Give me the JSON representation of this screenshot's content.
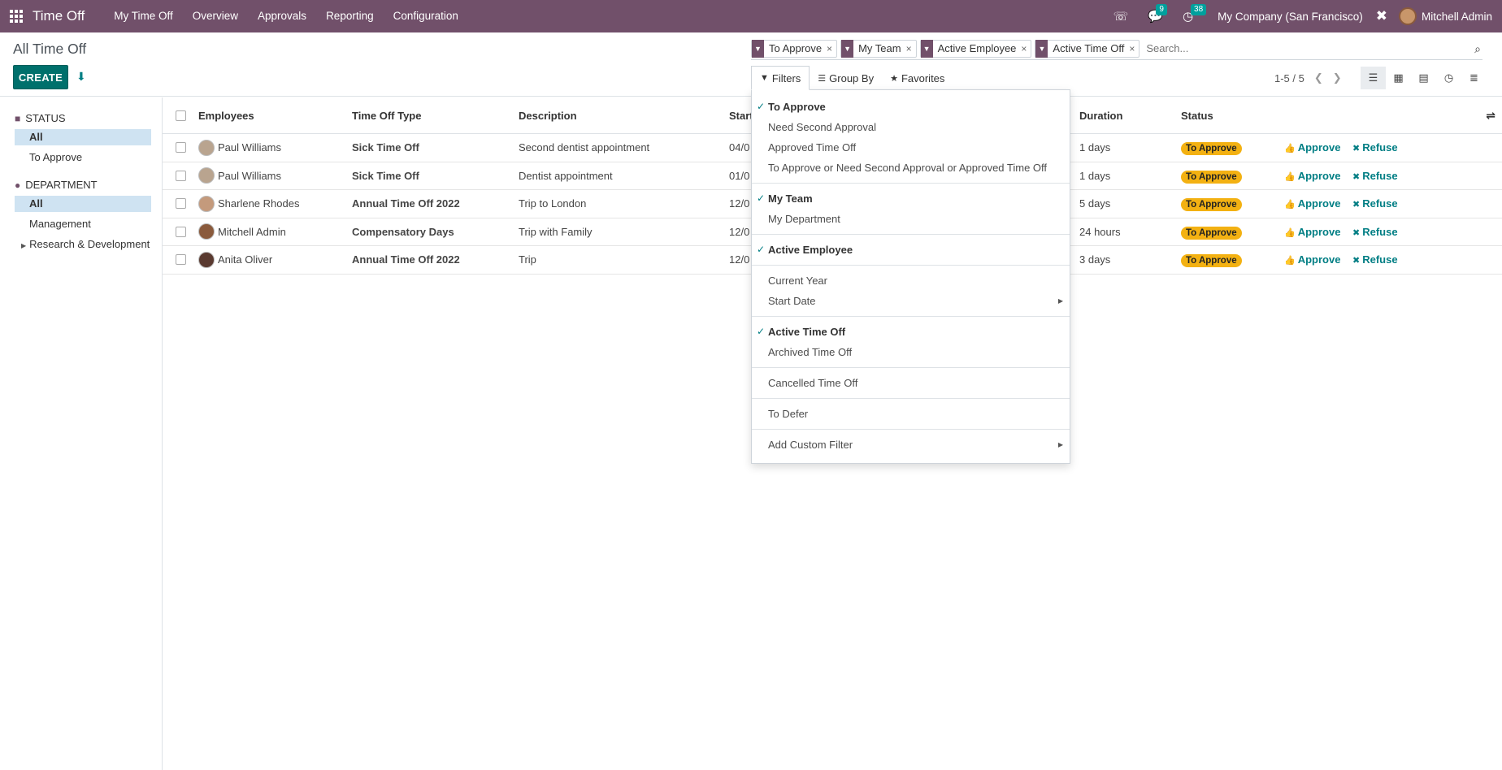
{
  "navbar": {
    "brand": "Time Off",
    "menu": [
      "My Time Off",
      "Overview",
      "Approvals",
      "Reporting",
      "Configuration"
    ],
    "messages_count": "9",
    "activities_count": "38",
    "company": "My Company (San Francisco)",
    "user": "Mitchell Admin"
  },
  "control_panel": {
    "title": "All Time Off",
    "create_label": "CREATE",
    "facets": [
      "To Approve",
      "My Team",
      "Active Employee",
      "Active Time Off"
    ],
    "search_placeholder": "Search...",
    "filters_label": "Filters",
    "groupby_label": "Group By",
    "favorites_label": "Favorites",
    "pager": "1-5 / 5"
  },
  "sidebar": {
    "status_header": "STATUS",
    "status_items": [
      "All",
      "To Approve"
    ],
    "department_header": "DEPARTMENT",
    "department_items": [
      "All",
      "Management",
      "Research & Development"
    ]
  },
  "table": {
    "headers": {
      "employees": "Employees",
      "type": "Time Off Type",
      "description": "Description",
      "start": "Start",
      "duration": "Duration",
      "status": "Status"
    },
    "approve_label": "Approve",
    "refuse_label": "Refuse",
    "rows": [
      {
        "employee": "Paul Williams",
        "type": "Sick Time Off",
        "description": "Second dentist appointment",
        "start": "04/0",
        "duration": "1 days",
        "status": "To Approve"
      },
      {
        "employee": "Paul Williams",
        "type": "Sick Time Off",
        "description": "Dentist appointment",
        "start": "01/0",
        "duration": "1 days",
        "status": "To Approve"
      },
      {
        "employee": "Sharlene Rhodes",
        "type": "Annual Time Off 2022",
        "description": "Trip to London",
        "start": "12/0",
        "duration": "5 days",
        "status": "To Approve"
      },
      {
        "employee": "Mitchell Admin",
        "type": "Compensatory Days",
        "description": "Trip with Family",
        "start": "12/0",
        "duration": "24 hours",
        "status": "To Approve"
      },
      {
        "employee": "Anita Oliver",
        "type": "Annual Time Off 2022",
        "description": "Trip",
        "start": "12/0",
        "duration": "3 days",
        "status": "To Approve"
      }
    ]
  },
  "filters_menu": {
    "group1": [
      "To Approve",
      "Need Second Approval",
      "Approved Time Off",
      "To Approve or Need Second Approval or Approved Time Off"
    ],
    "group2": [
      "My Team",
      "My Department"
    ],
    "group3": [
      "Active Employee"
    ],
    "group4": [
      "Current Year",
      "Start Date"
    ],
    "group5": [
      "Active Time Off",
      "Archived Time Off"
    ],
    "group6": [
      "Cancelled Time Off"
    ],
    "group7": [
      "To Defer"
    ],
    "group8": [
      "Add Custom Filter"
    ]
  },
  "colors": {
    "brand": "#71506a",
    "primary": "#00706c",
    "link": "#017e84",
    "status_badge": "#f3b112",
    "counter_badge": "#00a09d"
  }
}
